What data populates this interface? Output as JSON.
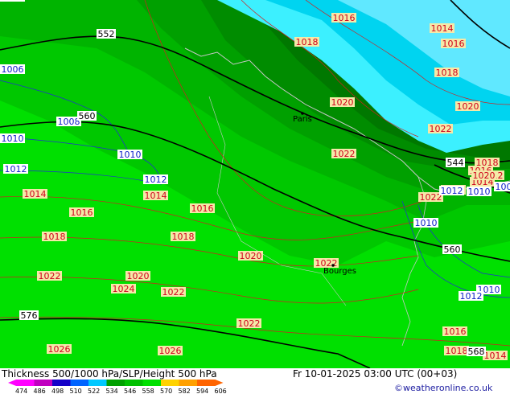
{
  "title": "Thickness 500/1000 hPa/SLP/Height 500 hPa",
  "valid_time": "Fr 10-01-2025 03:00 UTC (00+03)",
  "credit": "©weatheronline.co.uk",
  "legend": {
    "values": [
      "474",
      "486",
      "498",
      "510",
      "522",
      "534",
      "546",
      "558",
      "570",
      "582",
      "594",
      "606"
    ],
    "colors": [
      "#ff00ff",
      "#c000c0",
      "#1400c8",
      "#0064ff",
      "#00c8ff",
      "#00a000",
      "#00c000",
      "#00e000",
      "#ffd200",
      "#ffa000",
      "#ff6400"
    ]
  },
  "cities": [
    {
      "name": "Paris"
    },
    {
      "name": "Bourges"
    }
  ],
  "pressure_labels": [
    {
      "text": "1016",
      "kind": "slp"
    },
    {
      "text": "1016",
      "kind": "slp"
    },
    {
      "text": "1012",
      "kind": "slp"
    },
    {
      "text": "1014",
      "kind": "slp"
    },
    {
      "text": "1016",
      "kind": "slp"
    },
    {
      "text": "1018",
      "kind": "slp"
    },
    {
      "text": "1018",
      "kind": "slp"
    },
    {
      "text": "1020",
      "kind": "slp"
    },
    {
      "text": "1020",
      "kind": "slp"
    },
    {
      "text": "1022",
      "kind": "slp"
    },
    {
      "text": "1022",
      "kind": "slp"
    },
    {
      "text": "1020",
      "kind": "slp"
    },
    {
      "text": "1018",
      "kind": "slp"
    },
    {
      "text": "1014",
      "kind": "slp"
    },
    {
      "text": "1022",
      "kind": "slp"
    },
    {
      "text": "1012",
      "kind": "slp"
    },
    {
      "text": "1014",
      "kind": "slp"
    },
    {
      "text": "1016",
      "kind": "slp"
    },
    {
      "text": "1014",
      "kind": "slp"
    },
    {
      "text": "1016",
      "kind": "slp"
    },
    {
      "text": "1018",
      "kind": "slp"
    },
    {
      "text": "1018",
      "kind": "slp"
    },
    {
      "text": "1020",
      "kind": "slp"
    },
    {
      "text": "1022",
      "kind": "slp"
    },
    {
      "text": "1022",
      "kind": "slp"
    },
    {
      "text": "1020",
      "kind": "slp"
    },
    {
      "text": "1024",
      "kind": "slp"
    },
    {
      "text": "1022",
      "kind": "slp"
    },
    {
      "text": "1022",
      "kind": "slp"
    },
    {
      "text": "1026",
      "kind": "slp"
    },
    {
      "text": "1026",
      "kind": "slp"
    },
    {
      "text": "1016",
      "kind": "slp"
    },
    {
      "text": "1018",
      "kind": "slp"
    },
    {
      "text": "1014",
      "kind": "slp"
    },
    {
      "text": "1006",
      "kind": "iso"
    },
    {
      "text": "1008",
      "kind": "iso"
    },
    {
      "text": "1010",
      "kind": "iso"
    },
    {
      "text": "1010",
      "kind": "iso"
    },
    {
      "text": "1012",
      "kind": "iso"
    },
    {
      "text": "1012",
      "kind": "iso"
    },
    {
      "text": "1010",
      "kind": "iso"
    },
    {
      "text": "1010",
      "kind": "iso"
    },
    {
      "text": "1010",
      "kind": "iso"
    },
    {
      "text": "1012",
      "kind": "iso"
    },
    {
      "text": "1010",
      "kind": "iso"
    },
    {
      "text": "1012",
      "kind": "iso"
    },
    {
      "text": "100",
      "kind": "iso"
    }
  ],
  "height_labels": [
    {
      "text": "552"
    },
    {
      "text": "560"
    },
    {
      "text": "544"
    },
    {
      "text": "560"
    },
    {
      "text": "576"
    },
    {
      "text": "568"
    }
  ]
}
